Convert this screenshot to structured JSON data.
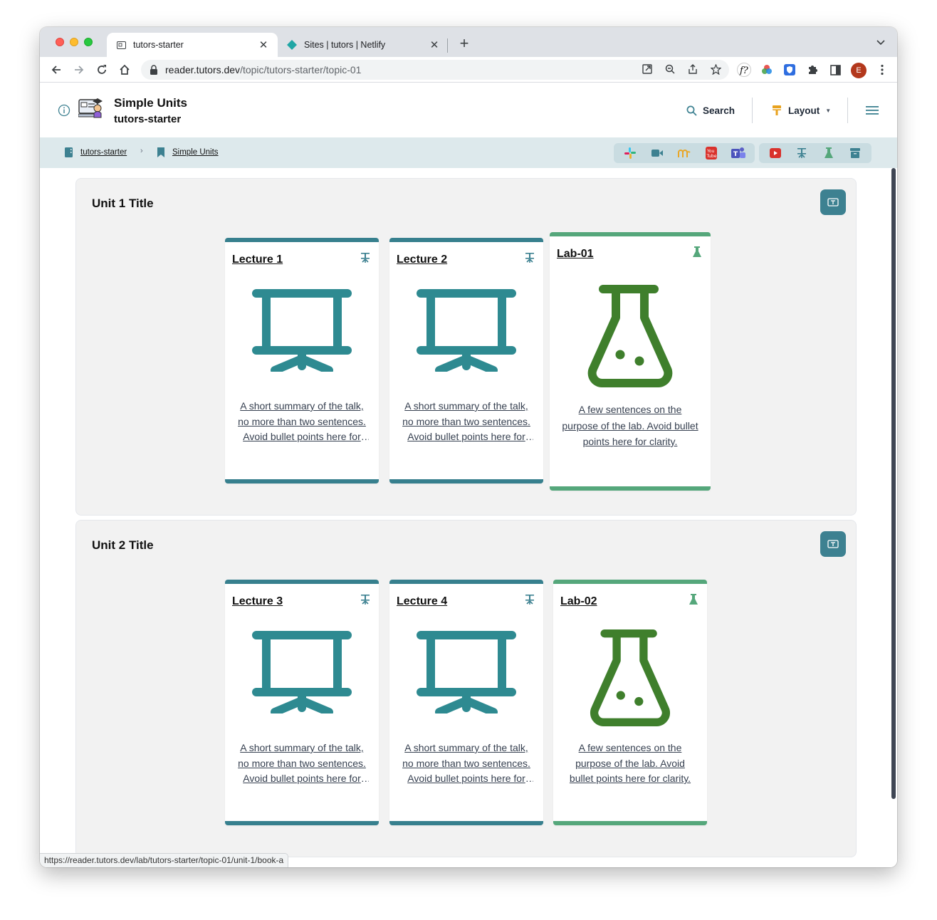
{
  "browser": {
    "tabs": [
      {
        "title": "tutors-starter",
        "active": true
      },
      {
        "title": "Sites | tutors | Netlify",
        "active": false
      }
    ],
    "url_host": "reader.tutors.dev",
    "url_path": "/topic/tutors-starter/topic-01",
    "profile_initial": "E",
    "status_url": "https://reader.tutors.dev/lab/tutors-starter/topic-01/unit-1/book-a"
  },
  "header": {
    "title": "Simple Units",
    "subtitle": "tutors-starter",
    "search_label": "Search",
    "layout_label": "Layout"
  },
  "breadcrumb": [
    {
      "label": "tutors-starter",
      "icon": "book-icon"
    },
    {
      "label": "Simple Units",
      "icon": "bookmark-icon"
    }
  ],
  "units": [
    {
      "title": "Unit 1 Title",
      "cards": [
        {
          "type": "lecture",
          "title": "Lecture 1",
          "summary": "A short summary of the talk, no more than two sentences. Avoid bullet points here for clarity."
        },
        {
          "type": "lecture",
          "title": "Lecture 2",
          "summary": "A short summary of the talk, no more than two sentences. Avoid bullet points here for clarity."
        },
        {
          "type": "lab",
          "title": "Lab-01",
          "summary": "A few sentences on the purpose of the lab. Avoid bullet points here for clarity."
        }
      ]
    },
    {
      "title": "Unit 2 Title",
      "cards": [
        {
          "type": "lecture",
          "title": "Lecture 3",
          "summary": "A short summary of the talk, no more than two sentences. Avoid bullet points here for clarity."
        },
        {
          "type": "lecture",
          "title": "Lecture 4",
          "summary": "A short summary of the talk, no more than two sentences. Avoid bullet points here for clarity."
        },
        {
          "type": "lab",
          "title": "Lab-02",
          "summary": "A few sentences on the purpose of the lab. Avoid bullet points here for clarity."
        }
      ]
    }
  ],
  "colors": {
    "lecture": "#37808e",
    "lecture_icon": "#2e8a91",
    "lab": "#55a77b",
    "lab_icon": "#3f7f2c",
    "crumb_bar": "#dde9ec"
  }
}
